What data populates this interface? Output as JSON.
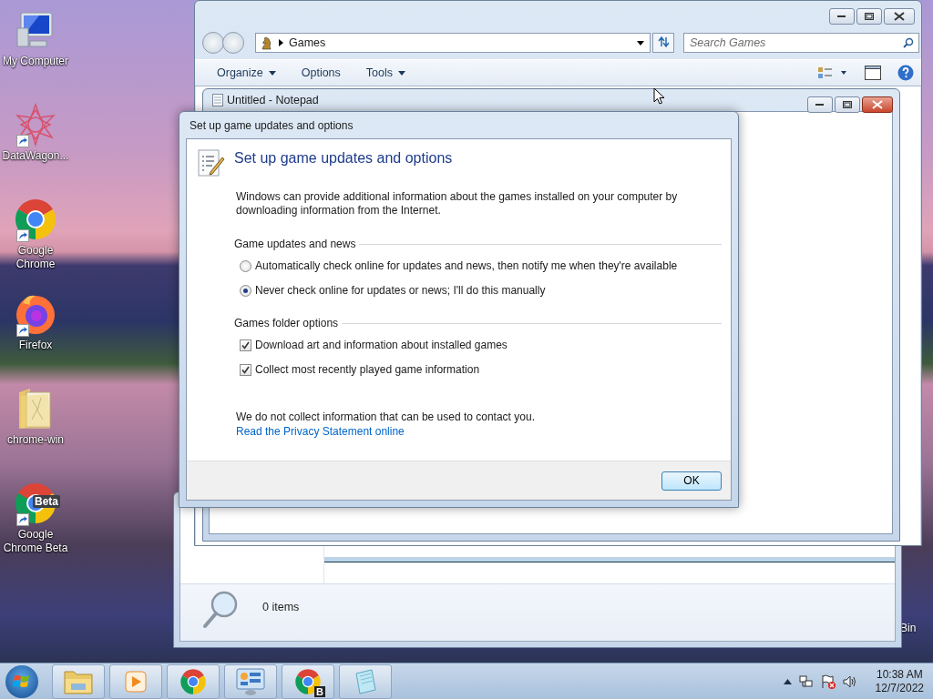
{
  "desktop": {
    "icons": [
      {
        "label": "My Computer",
        "kind": "computer",
        "shortcut": false
      },
      {
        "label": "DataWagon...",
        "kind": "star",
        "shortcut": true
      },
      {
        "label": "Google Chrome",
        "kind": "chrome",
        "shortcut": true
      },
      {
        "label": "Firefox",
        "kind": "firefox",
        "shortcut": true
      },
      {
        "label": "chrome-win",
        "kind": "folder",
        "shortcut": false
      },
      {
        "label": "Google Chrome Beta",
        "kind": "chrome-beta",
        "shortcut": true,
        "badge": "Beta"
      }
    ],
    "partial_icon_label": "Bin"
  },
  "explorer_window": {
    "status": "0 items"
  },
  "games_window": {
    "address": "Games",
    "search": {
      "placeholder": "Search Games"
    },
    "toolbar": [
      {
        "label": "Organize",
        "menu": true
      },
      {
        "label": "Options",
        "menu": false
      },
      {
        "label": "Tools",
        "menu": true
      }
    ]
  },
  "notepad_window": {
    "title": "Untitled - Notepad"
  },
  "dialog": {
    "title": "Set up game updates and options",
    "heading": "Set up game updates and options",
    "intro": "Windows can provide additional information about the games installed on your computer by downloading information from the Internet.",
    "update_group": "Game updates and news",
    "update_options": [
      {
        "label": "Automatically check online for updates and news, then notify me when they're available",
        "selected": false
      },
      {
        "label": "Never check online for updates or news; I'll do this manually",
        "selected": true
      }
    ],
    "folder_group": "Games folder options",
    "folder_options": [
      {
        "label": "Download art and information about installed games",
        "checked": true
      },
      {
        "label": "Collect most recently played game information",
        "checked": true
      }
    ],
    "note": "We do not collect information that can be used to contact you.",
    "link": "Read the Privacy Statement online",
    "ok": "OK"
  },
  "taskbar": {
    "items": [
      {
        "kind": "folder"
      },
      {
        "kind": "media"
      },
      {
        "kind": "chrome"
      },
      {
        "kind": "control-panel"
      },
      {
        "kind": "chrome-beta",
        "badge": "B"
      },
      {
        "kind": "notepad"
      }
    ],
    "time": "10:38 AM",
    "date": "12/7/2022"
  }
}
